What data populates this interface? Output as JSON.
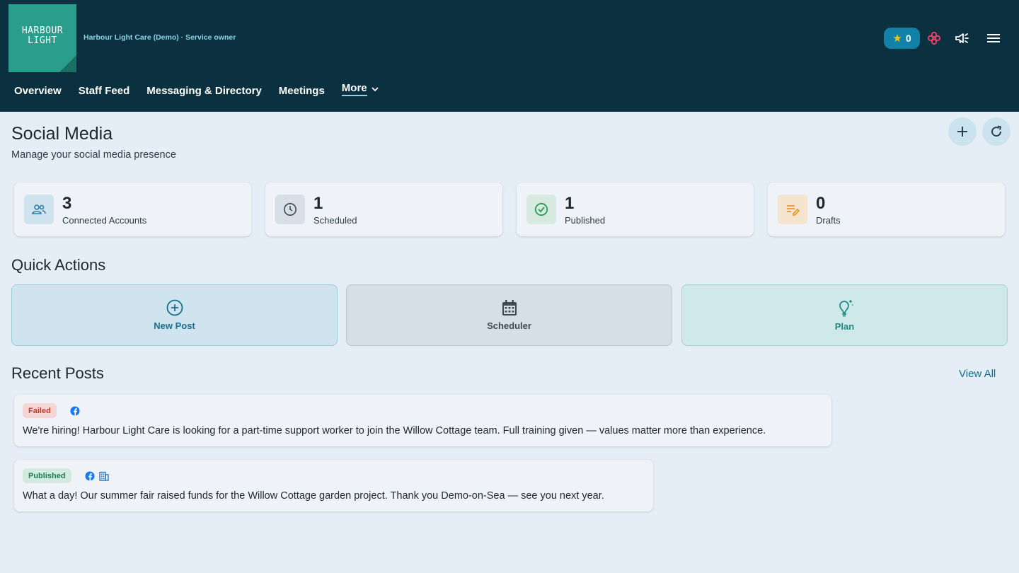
{
  "header": {
    "logo_text": "HARBOUR\nLIGHT",
    "org_line": "Harbour Light Care (Demo) · Service owner",
    "points": "0",
    "icons": [
      "star-icon",
      "flower-icon",
      "megaphone-icon",
      "menu-icon"
    ]
  },
  "nav": {
    "items": [
      "Overview",
      "Staff Feed",
      "Messaging & Directory",
      "Meetings"
    ],
    "more_label": "More"
  },
  "page": {
    "title": "Social Media",
    "subtitle": "Manage your social media presence"
  },
  "stats": [
    {
      "value": "3",
      "label": "Connected Accounts",
      "icon": "users-icon"
    },
    {
      "value": "1",
      "label": "Scheduled",
      "icon": "clock-icon"
    },
    {
      "value": "1",
      "label": "Published",
      "icon": "check-circle-icon"
    },
    {
      "value": "0",
      "label": "Drafts",
      "icon": "edit-notes-icon"
    }
  ],
  "quick_actions": {
    "title": "Quick Actions",
    "items": [
      {
        "label": "New Post",
        "icon": "plus-circle-icon"
      },
      {
        "label": "Scheduler",
        "icon": "calendar-icon"
      },
      {
        "label": "Plan",
        "icon": "lightbulb-icon"
      }
    ]
  },
  "recent_posts": {
    "title": "Recent Posts",
    "view_all": "View All",
    "items": [
      {
        "status": "Failed",
        "platforms": [
          "facebook-icon"
        ],
        "text": "We're hiring! Harbour Light Care is looking for a part-time support worker to join the Willow Cottage team. Full training given — values matter more than experience."
      },
      {
        "status": "Published",
        "platforms": [
          "facebook-icon",
          "building-icon"
        ],
        "text": "What a day! Our summer fair raised funds for the Willow Cottage garden project. Thank you Demo-on-Sea — see you next year."
      }
    ]
  },
  "colors": {
    "header_bg": "#0b3040",
    "accent": "#146a8a",
    "failed": "#c0392b",
    "published": "#1f7a5a"
  }
}
